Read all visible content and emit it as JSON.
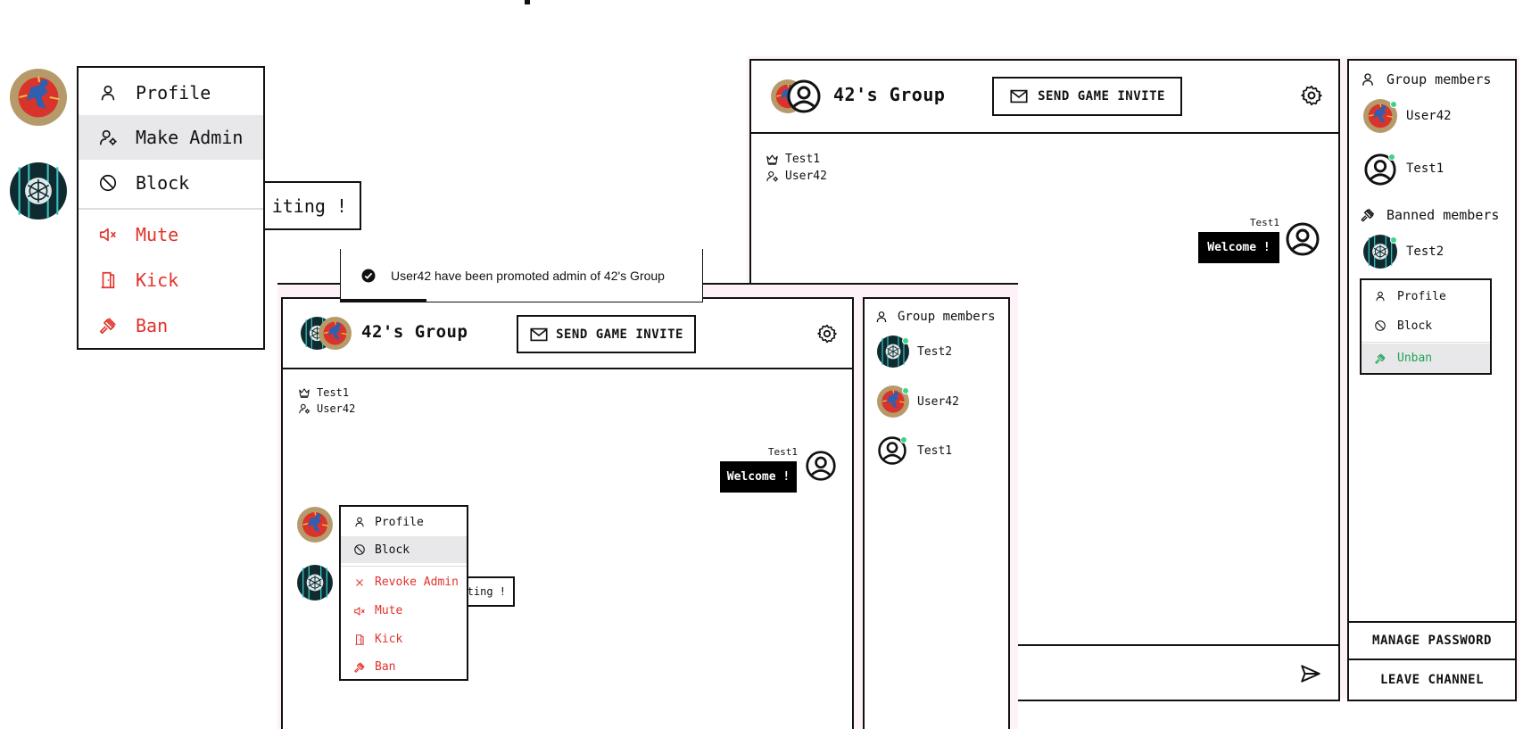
{
  "large_menu": {
    "items": [
      {
        "label": "Profile",
        "icon": "user-icon"
      },
      {
        "label": "Make Admin",
        "icon": "user-cog-icon"
      },
      {
        "label": "Block",
        "icon": "block-icon"
      },
      {
        "label": "Mute",
        "icon": "mute-icon"
      },
      {
        "label": "Kick",
        "icon": "door-icon"
      },
      {
        "label": "Ban",
        "icon": "gavel-icon"
      }
    ],
    "behind_text": "iting !"
  },
  "toast": {
    "text": "User42 have been promoted admin of 42's Group"
  },
  "window_front": {
    "group_name": "42's Group",
    "invite_label": "SEND GAME INVITE",
    "roles": [
      {
        "icon": "crown-icon",
        "name": "Test1"
      },
      {
        "icon": "user-cog-icon",
        "name": "User42"
      }
    ],
    "message": {
      "sender": "Test1",
      "text": "Welcome !"
    },
    "behind_text": "ting !",
    "context_menu": {
      "items": [
        {
          "label": "Profile",
          "icon": "user-icon"
        },
        {
          "label": "Block",
          "icon": "block-icon"
        },
        {
          "label": "Revoke Admin",
          "icon": "x-icon"
        },
        {
          "label": "Mute",
          "icon": "mute-icon"
        },
        {
          "label": "Kick",
          "icon": "door-icon"
        },
        {
          "label": "Ban",
          "icon": "gavel-icon"
        }
      ]
    },
    "members_title": "Group members",
    "members": [
      "Test2",
      "User42",
      "Test1"
    ]
  },
  "window_back": {
    "group_name": "42's Group",
    "invite_label": "SEND GAME INVITE",
    "roles": [
      {
        "icon": "crown-icon",
        "name": "Test1"
      },
      {
        "icon": "user-cog-icon",
        "name": "User42"
      }
    ],
    "message": {
      "sender": "Test1",
      "text": "Welcome !"
    },
    "members_title": "Group members",
    "members": [
      "User42",
      "Test1"
    ],
    "banned_title": "Banned members",
    "banned": [
      "Test2"
    ],
    "banned_menu": [
      {
        "label": "Profile",
        "icon": "user-icon"
      },
      {
        "label": "Block",
        "icon": "block-icon"
      },
      {
        "label": "Unban",
        "icon": "gavel-icon"
      }
    ],
    "manage_password_label": "MANAGE PASSWORD",
    "leave_channel_label": "LEAVE CHANNEL"
  },
  "colors": {
    "danger": "#e0332c",
    "success": "#22a455",
    "online": "#3fd38a",
    "pink": "#fcf2f7"
  }
}
